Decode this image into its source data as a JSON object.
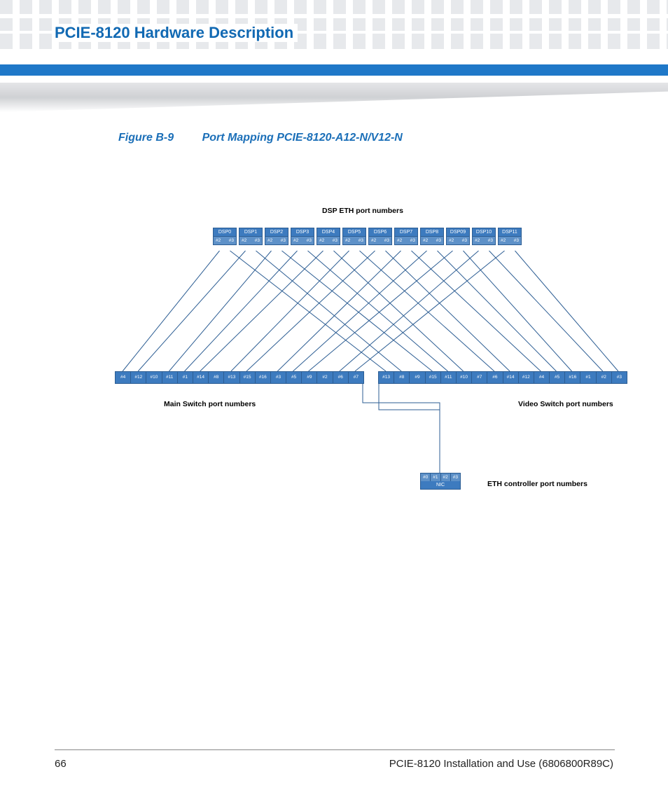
{
  "header": {
    "chapter_title": "PCIE-8120 Hardware Description"
  },
  "figure": {
    "number": "Figure B-9",
    "caption": "Port Mapping PCIE-8120-A12-N/V12-N"
  },
  "diagram": {
    "dsp_header": "DSP ETH port numbers",
    "main_switch_label": "Main Switch port numbers",
    "video_switch_label": "Video Switch port numbers",
    "eth_ctrl_label": "ETH controller port numbers",
    "dsp_sub_left": "#2",
    "dsp_sub_right": "#3",
    "dsps": [
      "DSP0",
      "DSP1",
      "DSP2",
      "DSP3",
      "DSP4",
      "DSP5",
      "DSP6",
      "DSP7",
      "DSP8",
      "DSP09",
      "DSP10",
      "DSP11"
    ],
    "main_switch_ports": [
      "#4",
      "#12",
      "#10",
      "#11",
      "#1",
      "#14",
      "#8",
      "#13",
      "#15",
      "#16",
      "#3",
      "#5",
      "#9",
      "#2",
      "#6",
      "#7"
    ],
    "video_switch_ports": [
      "#13",
      "#8",
      "#9",
      "#15",
      "#11",
      "#10",
      "#7",
      "#6",
      "#14",
      "#12",
      "#4",
      "#5",
      "#16",
      "#1",
      "#2",
      "#3"
    ],
    "nic": {
      "ports": [
        "#0",
        "#1",
        "#2",
        "#3"
      ],
      "label": "NIC"
    }
  },
  "footer": {
    "page": "66",
    "title": "PCIE-8120 Installation and Use (6806800R89C)"
  }
}
